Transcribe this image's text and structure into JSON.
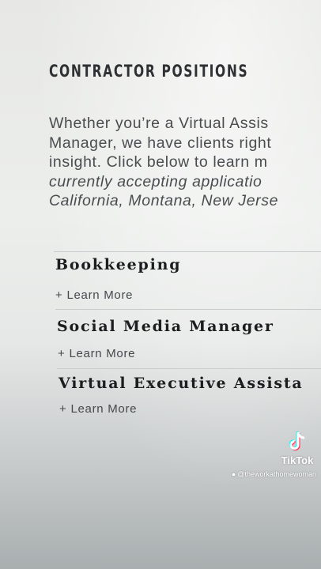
{
  "page": {
    "heading": "CONTRACTOR POSITIONS",
    "intro_lines": [
      "Whether you’re a Virtual Assis",
      "Manager, we have clients right",
      "insight. Click below to learn m",
      "currently accepting applicatio",
      "California, Montana, New Jerse"
    ]
  },
  "positions": [
    {
      "title": "Bookkeeping",
      "action": "Learn More",
      "action_prefix": "+"
    },
    {
      "title": "Social Media Manager",
      "action": "Learn More",
      "action_prefix": "+"
    },
    {
      "title": "Virtual Executive Assista",
      "action": "Learn More",
      "action_prefix": "+"
    }
  ],
  "overlay": {
    "brand": "TikTok",
    "handle": "@theworkathomewoman",
    "icon": "tiktok-logo-icon"
  },
  "colors": {
    "text_dark": "#1c1d1f",
    "text_body": "#4a4c4f",
    "divider": "#c9cbcc"
  }
}
